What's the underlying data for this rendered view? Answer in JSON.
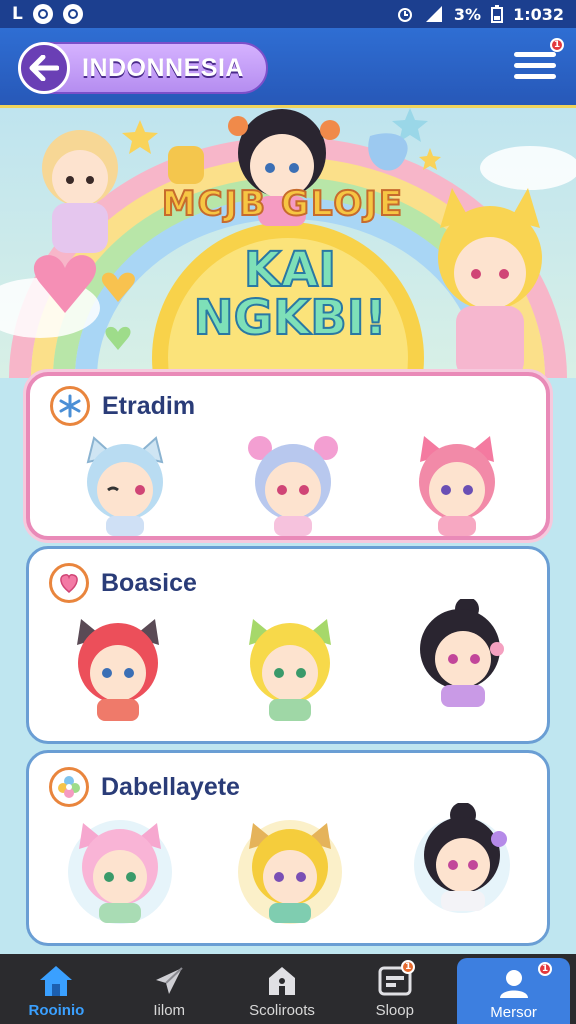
{
  "status_bar": {
    "left_letter": "L",
    "battery_percent": "3%",
    "time": "1:032"
  },
  "header": {
    "title": "INDONNESIA",
    "menu_badge": "1"
  },
  "hero": {
    "top_text": "MCJB GLOJE",
    "title_line1": "KAI",
    "title_line2": "NGKBI!"
  },
  "categories": [
    {
      "label": "Etradim",
      "icon": "snowflake-icon",
      "border": "#e98ab8",
      "avatars": [
        "sky-blue-cat-girl",
        "lavender-bow-girl",
        "pink-cat-girl"
      ]
    },
    {
      "label": "Boasice",
      "icon": "heart-icon",
      "border": "#6a9ed4",
      "avatars": [
        "red-cat-girl",
        "yellow-cat-girl",
        "black-hair-girl"
      ]
    },
    {
      "label": "Dabellayete",
      "icon": "flower-icon",
      "border": "#6a9ed4",
      "avatars": [
        "pink-cat-girl",
        "blonde-cat-girl",
        "black-hair-bun-girl"
      ]
    }
  ],
  "bottom_nav": [
    {
      "label": "Rooinio",
      "icon": "home-icon",
      "active": true
    },
    {
      "label": "Iilom",
      "icon": "plane-icon",
      "active": false
    },
    {
      "label": "Scoliroots",
      "icon": "house-icon",
      "active": false
    },
    {
      "label": "Sloop",
      "icon": "shop-icon",
      "active": false,
      "badge": "1"
    },
    {
      "label": "Mersor",
      "icon": "profile-icon",
      "active": false,
      "badge": "1"
    }
  ],
  "colors": {
    "header_blue": "#2f6ed3",
    "card_pink": "#e98ab8",
    "card_blue": "#6a9ed4",
    "nav_bg": "#2b2b2e",
    "nav_active": "#3aa0ff"
  }
}
